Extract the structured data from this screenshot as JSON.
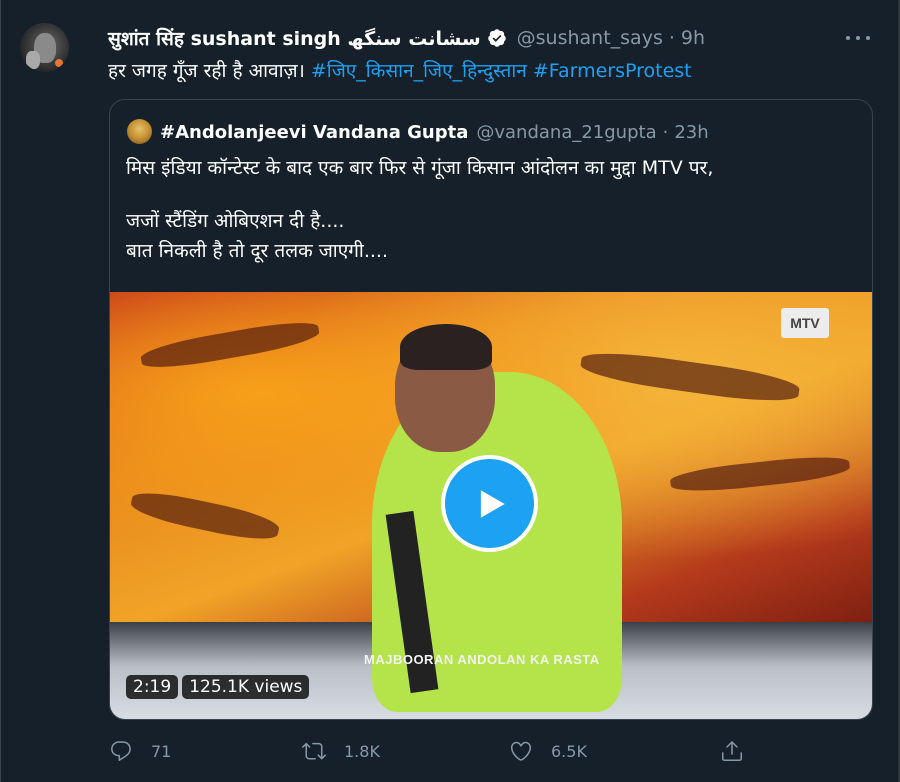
{
  "tweet": {
    "author_name": "सुशांत सिंह sushant singh سشانت سنگھ",
    "handle": "@sushant_says",
    "separator": "·",
    "time": "9h",
    "text_prefix": "हर जगह गूँज रही है आवाज़।",
    "hashtags": [
      "#जिए_किसान_जिए_हिन्दुस्तान",
      "#FarmersProtest"
    ]
  },
  "quoted": {
    "author_name": "#Andolanjeevi Vandana Gupta",
    "handle": "@vandana_21gupta",
    "separator": "·",
    "time": "23h",
    "lines": [
      "मिस इंडिया कॉन्टेस्ट के बाद एक बार फिर से गूंजा किसान आंदोलन का मुद्दा MTV पर,",
      "जजों स्टैंडिंग ओबिएशन दी है....",
      "बात निकली है तो दूर तलक जाएगी...."
    ],
    "video": {
      "duration": "2:19",
      "views": "125.1K views",
      "caption": "MAJBOORAN ANDOLAN KA RASTA",
      "logo": "MTV"
    }
  },
  "actions": {
    "reply_count": "71",
    "retweet_count": "1.8K",
    "like_count": "6.5K"
  },
  "colors": {
    "background": "#15202b",
    "accent": "#1da1f2",
    "muted": "#8899a6",
    "border": "#38444d"
  },
  "icons": {
    "verified": "verified-badge-icon",
    "more": "more-dots-icon",
    "play": "play-icon",
    "reply": "reply-icon",
    "retweet": "retweet-icon",
    "like": "heart-icon",
    "share": "share-icon"
  }
}
